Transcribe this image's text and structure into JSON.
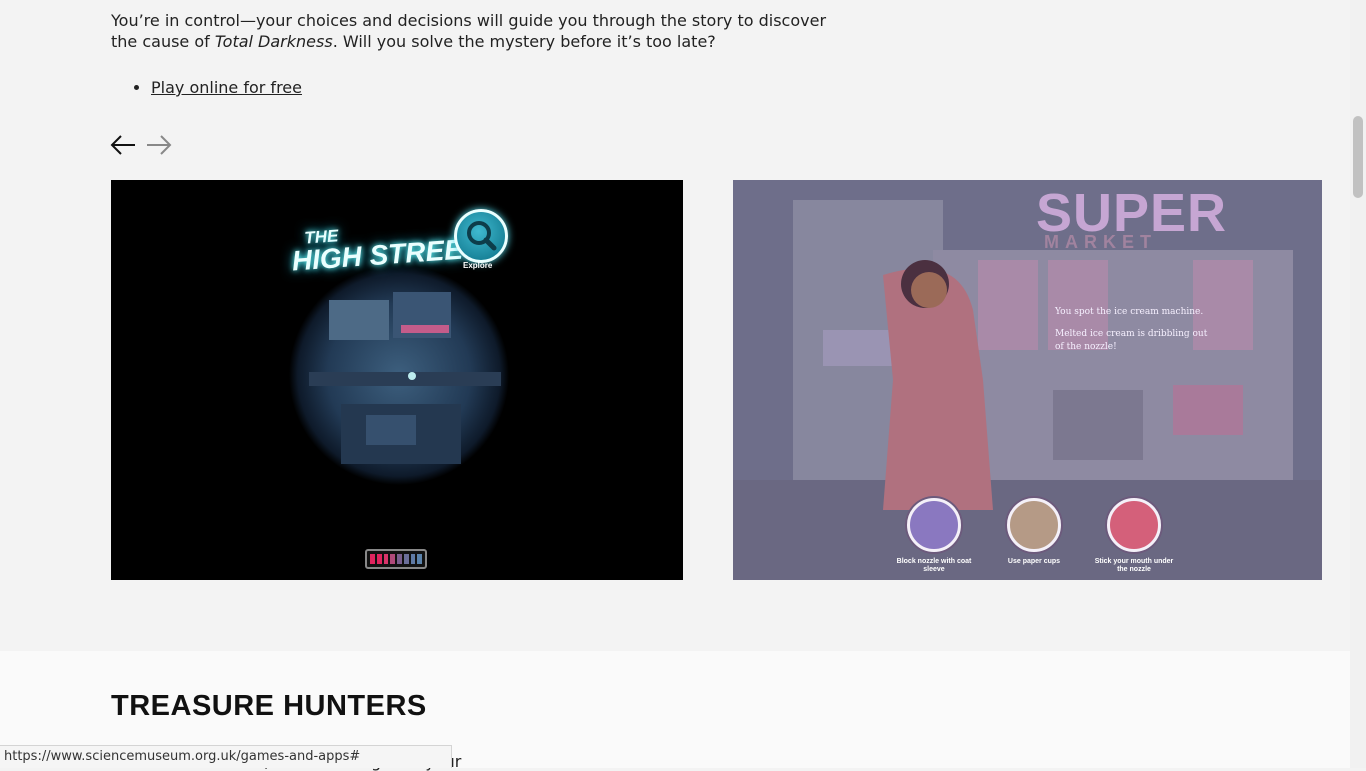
{
  "intro": {
    "part1": "You’re in control—your choices and decisions will guide you through the story to discover the cause of ",
    "title": "Total Darkness",
    "part2": ". Will you solve the mystery before it’s too late?"
  },
  "links": [
    {
      "label": "Play online for free"
    }
  ],
  "carousel": {
    "prev_icon": "arrow-left-icon",
    "next_icon": "arrow-right-icon",
    "slide1": {
      "title_line1": "THE",
      "title_line2": "HIGH STREET",
      "explore_label": "Explore",
      "battery_colors": [
        "#e0245e",
        "#e0245e",
        "#d8356a",
        "#b04a7a",
        "#7a5f8e",
        "#6b6f9a",
        "#5f7aa4",
        "#5a82ab"
      ]
    },
    "slide2": {
      "sign_top": "SUPER",
      "sign_bottom": "MARKET",
      "story_line1": "You spot the ice cream machine.",
      "story_line2": "Melted ice cream is dribbling out of the nozzle!",
      "choices": [
        {
          "label": "Block nozzle with coat sleeve",
          "color": "#8a78c0"
        },
        {
          "label": "Use paper cups",
          "color": "#b59a86"
        },
        {
          "label": "Stick your mouth under the nozzle",
          "color": "#d4607a"
        }
      ]
    }
  },
  "section": {
    "title": "TREASURE HUNTERS",
    "text": "our of the museum, and battle against your"
  },
  "status_url": "https://www.sciencemuseum.org.uk/games-and-apps#"
}
